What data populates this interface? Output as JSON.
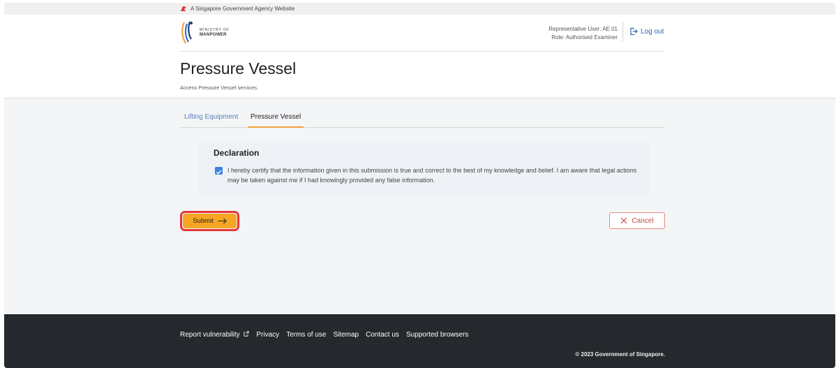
{
  "masthead": {
    "text": "A Singapore Government Agency Website"
  },
  "header": {
    "logo": {
      "line1": "MINISTRY OF",
      "line2": "MANPOWER"
    },
    "representative": "Representative User: AE 01",
    "role": "Role: Authorised Examiner",
    "logout_label": "Log out"
  },
  "page": {
    "title": "Pressure Vessel",
    "subtitle": "Access Pressure Vessel services."
  },
  "tabs": [
    {
      "label": "Lifting Equipment",
      "active": false
    },
    {
      "label": "Pressure Vessel",
      "active": true
    }
  ],
  "declaration": {
    "title": "Declaration",
    "checked": true,
    "text": "I hereby certify that the information given in this submission is true and correct to the best of my knowledge and belief. I am aware that legal actions may be taken against me if I had knowingly provided any false information."
  },
  "actions": {
    "submit_label": "Submit",
    "cancel_label": "Cancel"
  },
  "footer": {
    "links": [
      "Report vulnerability",
      "Privacy",
      "Terms of use",
      "Sitemap",
      "Contact us",
      "Supported browsers"
    ],
    "copyright": "© 2023 Government of Singapore."
  },
  "colors": {
    "accent": "#f6a623",
    "link": "#2d5fb5",
    "cancel": "#c7463b",
    "highlight": "#e4343a",
    "footer_bg": "#25282c"
  }
}
